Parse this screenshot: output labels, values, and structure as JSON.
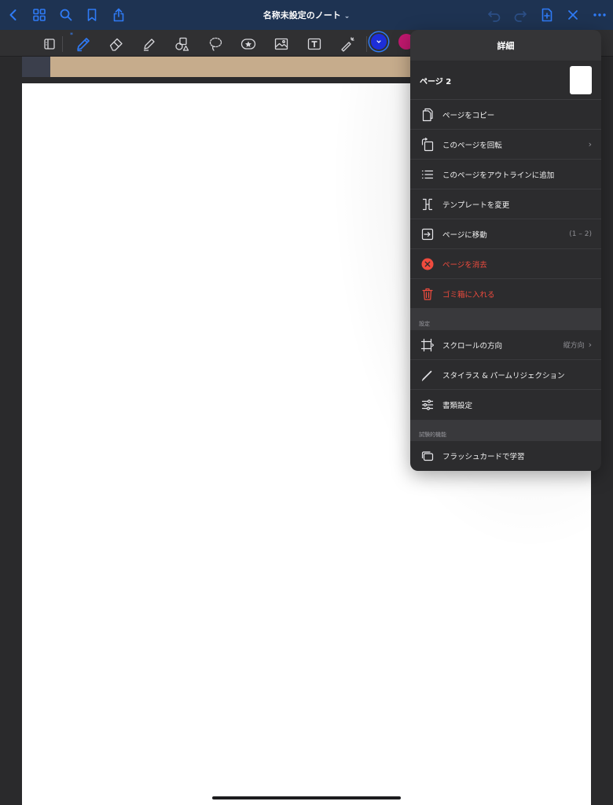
{
  "navbar": {
    "title": "名称未設定のノート",
    "title_chevron": "⌄",
    "back_icon": "chevron-left-icon",
    "grid_icon": "grid-icon",
    "search_icon": "search-icon",
    "bookmark_icon": "bookmark-icon",
    "share_icon": "share-icon",
    "undo_icon": "undo-icon",
    "redo_icon": "redo-icon",
    "add_page_icon": "add-page-icon",
    "close_icon": "close-icon",
    "more_icon": "more-icon"
  },
  "toolbar": {
    "tools": [
      "page-toggle-icon",
      "pen-icon",
      "eraser-icon",
      "highlighter-icon",
      "shapes-icon",
      "lasso-icon",
      "sticker-icon",
      "image-icon",
      "textbox-icon",
      "laser-pointer-icon"
    ],
    "active_tool": "pen-icon",
    "bluetooth_mark": "*",
    "colors": [
      "#1d2ed8",
      "#c2186f"
    ],
    "selected_color": "#1d2ed8"
  },
  "popover": {
    "title": "詳細",
    "page_label": "ページ 2",
    "items": [
      {
        "label": "ページをコピー",
        "icon": "copy-page-icon"
      },
      {
        "label": "このページを回転",
        "icon": "rotate-page-icon",
        "chevron": "›"
      },
      {
        "label": "このページをアウトラインに追加",
        "icon": "outline-list-icon"
      },
      {
        "label": "テンプレートを変更",
        "icon": "template-icon"
      },
      {
        "label": "ページに移動",
        "icon": "go-to-page-icon",
        "right_text": "(1 – 2)"
      },
      {
        "label": "ページを消去",
        "icon": "clear-page-icon",
        "destructive": true
      },
      {
        "label": "ゴミ箱に入れる",
        "icon": "trash-icon",
        "destructive": true
      }
    ],
    "settings_header": "設定",
    "settings_items": [
      {
        "label": "スクロールの方向",
        "icon": "scroll-direction-icon",
        "right_text": "縦方向",
        "chevron": "›"
      },
      {
        "label": "スタイラス & パームリジェクション",
        "icon": "stylus-icon"
      },
      {
        "label": "書類設定",
        "icon": "document-settings-icon"
      }
    ],
    "experimental_header": "試験的機能",
    "experimental_items": [
      {
        "label": "フラッシュカードで学習",
        "icon": "flashcard-icon"
      }
    ]
  },
  "colors": {
    "navbar_bg": "#1e3352",
    "accent": "#2f7bf6",
    "destructive": "#f04b3e",
    "popover_bg": "#2c2c2e"
  }
}
